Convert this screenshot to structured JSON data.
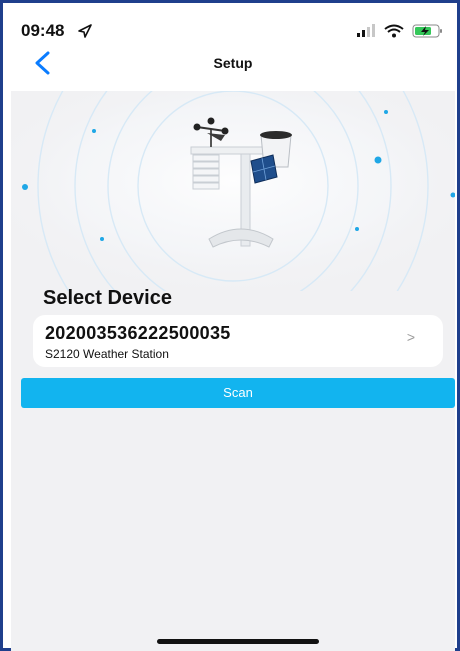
{
  "status_bar": {
    "time": "09:48",
    "icons": [
      "location-arrow-icon",
      "signal-icon",
      "wifi-icon",
      "battery-icon"
    ]
  },
  "nav": {
    "title": "Setup",
    "back_icon": "chevron-left-icon"
  },
  "hero": {
    "image": "weather-station-illustration"
  },
  "section": {
    "title": "Select Device"
  },
  "device": {
    "id": "202003536222500035",
    "name": "S2120 Weather Station",
    "chevron": ">"
  },
  "scan": {
    "label": "Scan"
  },
  "colors": {
    "accent": "#12b4ef",
    "back": "#0a7cff",
    "background": "#f1f1f3",
    "frame": "#1f3f8c"
  }
}
